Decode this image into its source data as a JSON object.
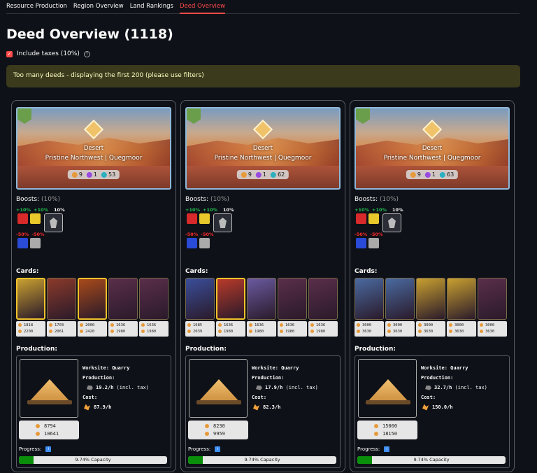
{
  "tabs": [
    {
      "label": "Resource Production",
      "active": false
    },
    {
      "label": "Region Overview",
      "active": false
    },
    {
      "label": "Land Rankings",
      "active": false
    },
    {
      "label": "Deed Overview",
      "active": true
    }
  ],
  "title": "Deed Overview (1118)",
  "include_taxes": {
    "label": "Include taxes (10%)",
    "checked": true
  },
  "warning": "Too many deeds - displaying the first 200 (please use filters)",
  "colors": {
    "accent": "#ff4b4b",
    "progress": "#0a8f0a",
    "warning_bg": "#3b3a1d"
  },
  "deeds": [
    {
      "type": "Desert",
      "region": "Pristine Northwest | Quegmoor",
      "stats": [
        "9",
        "1",
        "53"
      ],
      "boosts_label": "Boosts:",
      "boosts_pct": "(10%)",
      "boosts_pos": [
        "+10%",
        "+10%"
      ],
      "boosts_center": "10%",
      "boosts_neg": [
        "-50%",
        "-50%"
      ],
      "cards_label": "Cards:",
      "cards": [
        {
          "a": "1818",
          "b": "2200"
        },
        {
          "a": "1703",
          "b": "2061"
        },
        {
          "a": "2000",
          "b": "2420"
        },
        {
          "a": "1636",
          "b": "1980"
        },
        {
          "a": "1636",
          "b": "1980"
        }
      ],
      "production_label": "Production:",
      "worksite_label": "Worksite:",
      "worksite": "Quarry",
      "production_sub": "Production:",
      "production_rate": "19.2/h",
      "production_note": "(incl. tax)",
      "cost_label": "Cost:",
      "cost_rate": "87.9/h",
      "ws_stats": [
        "8794",
        "10641"
      ],
      "progress_label": "Progress:",
      "progress_info": "i",
      "progress_text": "9.74% Capacity",
      "progress_value": 0.0974
    },
    {
      "type": "Desert",
      "region": "Pristine Northwest | Quegmoor",
      "stats": [
        "9",
        "1",
        "62"
      ],
      "boosts_label": "Boosts:",
      "boosts_pct": "(10%)",
      "boosts_pos": [
        "+10%",
        "+10%"
      ],
      "boosts_center": "10%",
      "boosts_neg": [
        "-50%",
        "-50%"
      ],
      "cards_label": "Cards:",
      "cards": [
        {
          "a": "1685",
          "b": "2039"
        },
        {
          "a": "1636",
          "b": "1980"
        },
        {
          "a": "1636",
          "b": "1980"
        },
        {
          "a": "1636",
          "b": "1980"
        },
        {
          "a": "1636",
          "b": "1980"
        }
      ],
      "production_label": "Production:",
      "worksite_label": "Worksite:",
      "worksite": "Quarry",
      "production_sub": "Production:",
      "production_rate": "17.9/h",
      "production_note": "(incl. tax)",
      "cost_label": "Cost:",
      "cost_rate": "82.3/h",
      "ws_stats": [
        "8230",
        "9959"
      ],
      "progress_label": "Progress:",
      "progress_info": "i",
      "progress_text": "9.74% Capacity",
      "progress_value": 0.0974
    },
    {
      "type": "Desert",
      "region": "Pristine Northwest | Quegmoor",
      "stats": [
        "9",
        "1",
        "63"
      ],
      "boosts_label": "Boosts:",
      "boosts_pct": "(10%)",
      "boosts_pos": [
        "+10%",
        "+10%"
      ],
      "boosts_center": "10%",
      "boosts_neg": [
        "-50%",
        "-50%"
      ],
      "cards_label": "Cards:",
      "cards": [
        {
          "a": "3000",
          "b": "3630"
        },
        {
          "a": "3000",
          "b": "3630"
        },
        {
          "a": "3000",
          "b": "3630"
        },
        {
          "a": "3000",
          "b": "3630"
        },
        {
          "a": "3000",
          "b": "3630"
        }
      ],
      "production_label": "Production:",
      "worksite_label": "Worksite:",
      "worksite": "Quarry",
      "production_sub": "Production:",
      "production_rate": "32.7/h",
      "production_note": "(incl. tax)",
      "cost_label": "Cost:",
      "cost_rate": "150.0/h",
      "ws_stats": [
        "15000",
        "18150"
      ],
      "progress_label": "Progress:",
      "progress_info": "i",
      "progress_text": "9.74% Capacity",
      "progress_value": 0.0974
    }
  ]
}
